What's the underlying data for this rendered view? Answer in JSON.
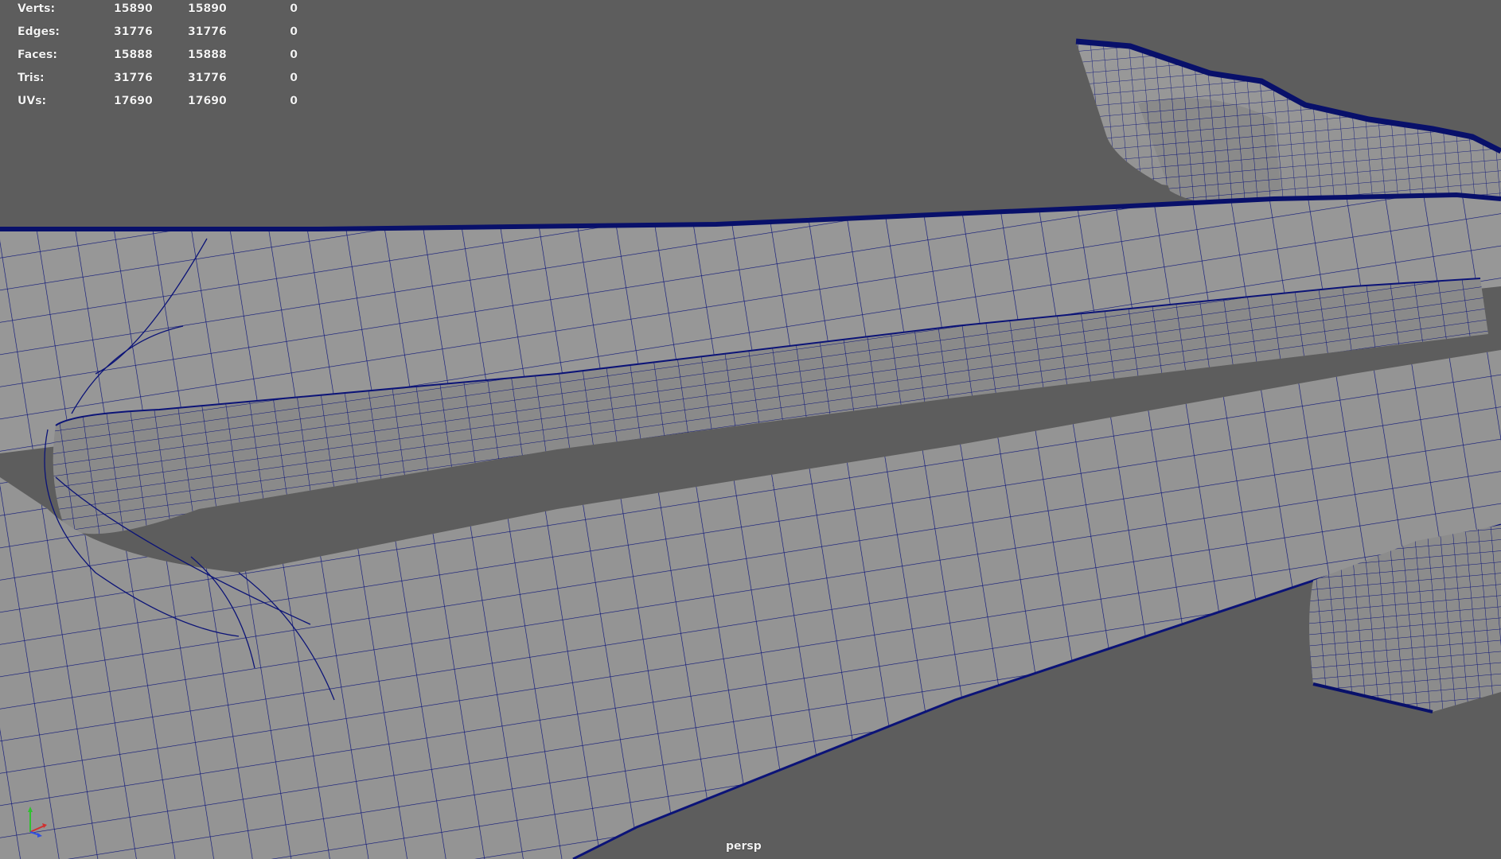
{
  "hud": {
    "rows": [
      {
        "label": "Verts:",
        "total": "15890",
        "selected": "15890",
        "hidden": "0"
      },
      {
        "label": "Edges:",
        "total": "31776",
        "selected": "31776",
        "hidden": "0"
      },
      {
        "label": "Faces:",
        "total": "15888",
        "selected": "15888",
        "hidden": "0"
      },
      {
        "label": "Tris:",
        "total": "31776",
        "selected": "31776",
        "hidden": "0"
      },
      {
        "label": "UVs:",
        "total": "17690",
        "selected": "17690",
        "hidden": "0"
      }
    ]
  },
  "viewport": {
    "camera": "persp",
    "background": "#5d5d5d",
    "mesh_fill": "#969696",
    "mesh_dark": "#7e7e7e",
    "wire_color": "#0b1377"
  },
  "axis_gizmo": {
    "x_color": "#d03030",
    "y_color": "#30c030",
    "z_color": "#3050e0"
  }
}
